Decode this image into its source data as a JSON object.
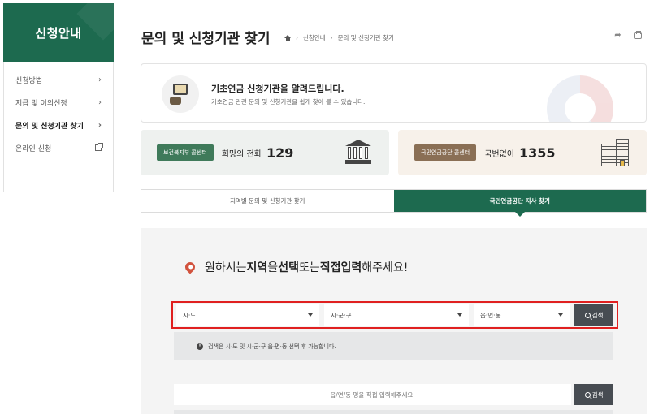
{
  "sidebar": {
    "title": "신청안내",
    "items": [
      {
        "label": "신청방법",
        "icon": "chevron-right-icon"
      },
      {
        "label": "지급 및 이의신청",
        "icon": "chevron-right-icon"
      },
      {
        "label": "문의 및 신청기관 찾기",
        "icon": "chevron-right-icon",
        "active": true
      },
      {
        "label": "온라인 신청",
        "icon": "external-link-icon"
      }
    ]
  },
  "header": {
    "title": "문의 및 신청기관 찾기",
    "breadcrumb": [
      "신청안내",
      "문의 및 신청기관 찾기"
    ]
  },
  "info": {
    "title": "기초연금 신청기관을 알려드립니다.",
    "subtitle": "기초연금 관련 문의 및 신청기관을 쉽게 찾아 볼 수 있습니다."
  },
  "cards": [
    {
      "badge": "보건복지부 콜센터",
      "label": "희망의 전화",
      "number": "129",
      "icon": "bank-building-icon"
    },
    {
      "badge": "국민연금공단 콜센터",
      "label": "국번없이",
      "number": "1355",
      "icon": "office-building-icon"
    }
  ],
  "tabs": [
    {
      "label": "지역별 문의 및 신청기관 찾기",
      "active": false
    },
    {
      "label": "국민연금공단 지사 찾기",
      "active": true
    }
  ],
  "search": {
    "heading_part1": "원하시는 ",
    "heading_hl1": "지역",
    "heading_part2": "을 ",
    "heading_hl2": "선택",
    "heading_part3": " 또는 ",
    "heading_hl3": "직접입력",
    "heading_part4": "해주세요!",
    "select_sido": "시·도",
    "select_sigungu": "시·군·구",
    "select_emd": "읍·면·동",
    "search_button": "검색",
    "notice": "검색은 시·도 및 시·군·구 읍·면·동 선택 후 가능합니다.",
    "direct_placeholder": "읍/면/동 명을 직접 입력해주세요.",
    "direct_button": "검색"
  },
  "colors": {
    "brand_green": "#1d6a4f",
    "highlight_border": "#e02020",
    "button_dark": "#474c52"
  }
}
